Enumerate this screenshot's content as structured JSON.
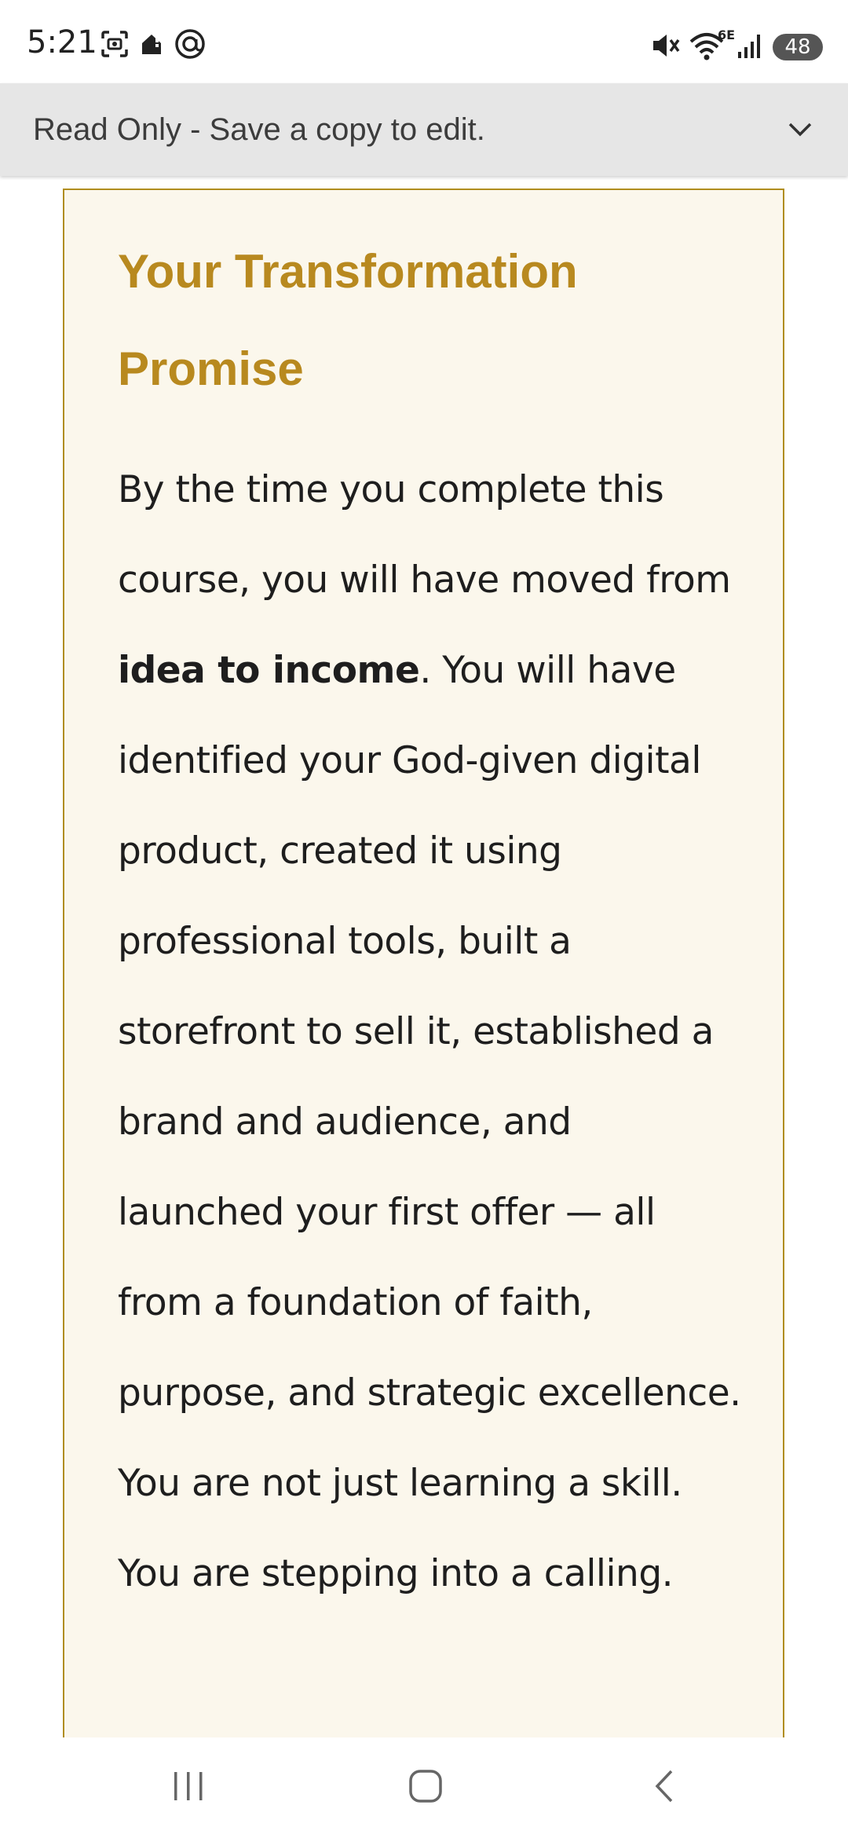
{
  "status_bar": {
    "time": "5:21",
    "battery_level": "48",
    "network_label": "6E",
    "icons": {
      "left": [
        "screenshot-icon",
        "home-alert-icon",
        "at-sign-icon"
      ],
      "right": [
        "mute-icon",
        "wifi-icon",
        "signal-icon"
      ]
    }
  },
  "banner": {
    "text": "Read Only - Save a copy to edit.",
    "icon": "chevron-down-icon"
  },
  "document": {
    "title": "Your Transformation Promise",
    "body_intro": "By the time you complete this course, you will have moved from ",
    "body_bold": "idea to income",
    "body_rest": ". You will have identified your God-given digital product, created it using professional tools, built a storefront to sell it, established a brand and audience, and launched your first offer — all from a foundation of faith, purpose, and strategic excellence. You are not just learning a skill. You are stepping into a calling."
  },
  "nav_bar": {
    "icons": [
      "recents-icon",
      "home-icon",
      "back-icon"
    ]
  },
  "colors": {
    "title": "#b8891f",
    "box_border": "#b08d1e",
    "box_background": "#fbf7ec",
    "banner_background": "#e6e6e6"
  }
}
